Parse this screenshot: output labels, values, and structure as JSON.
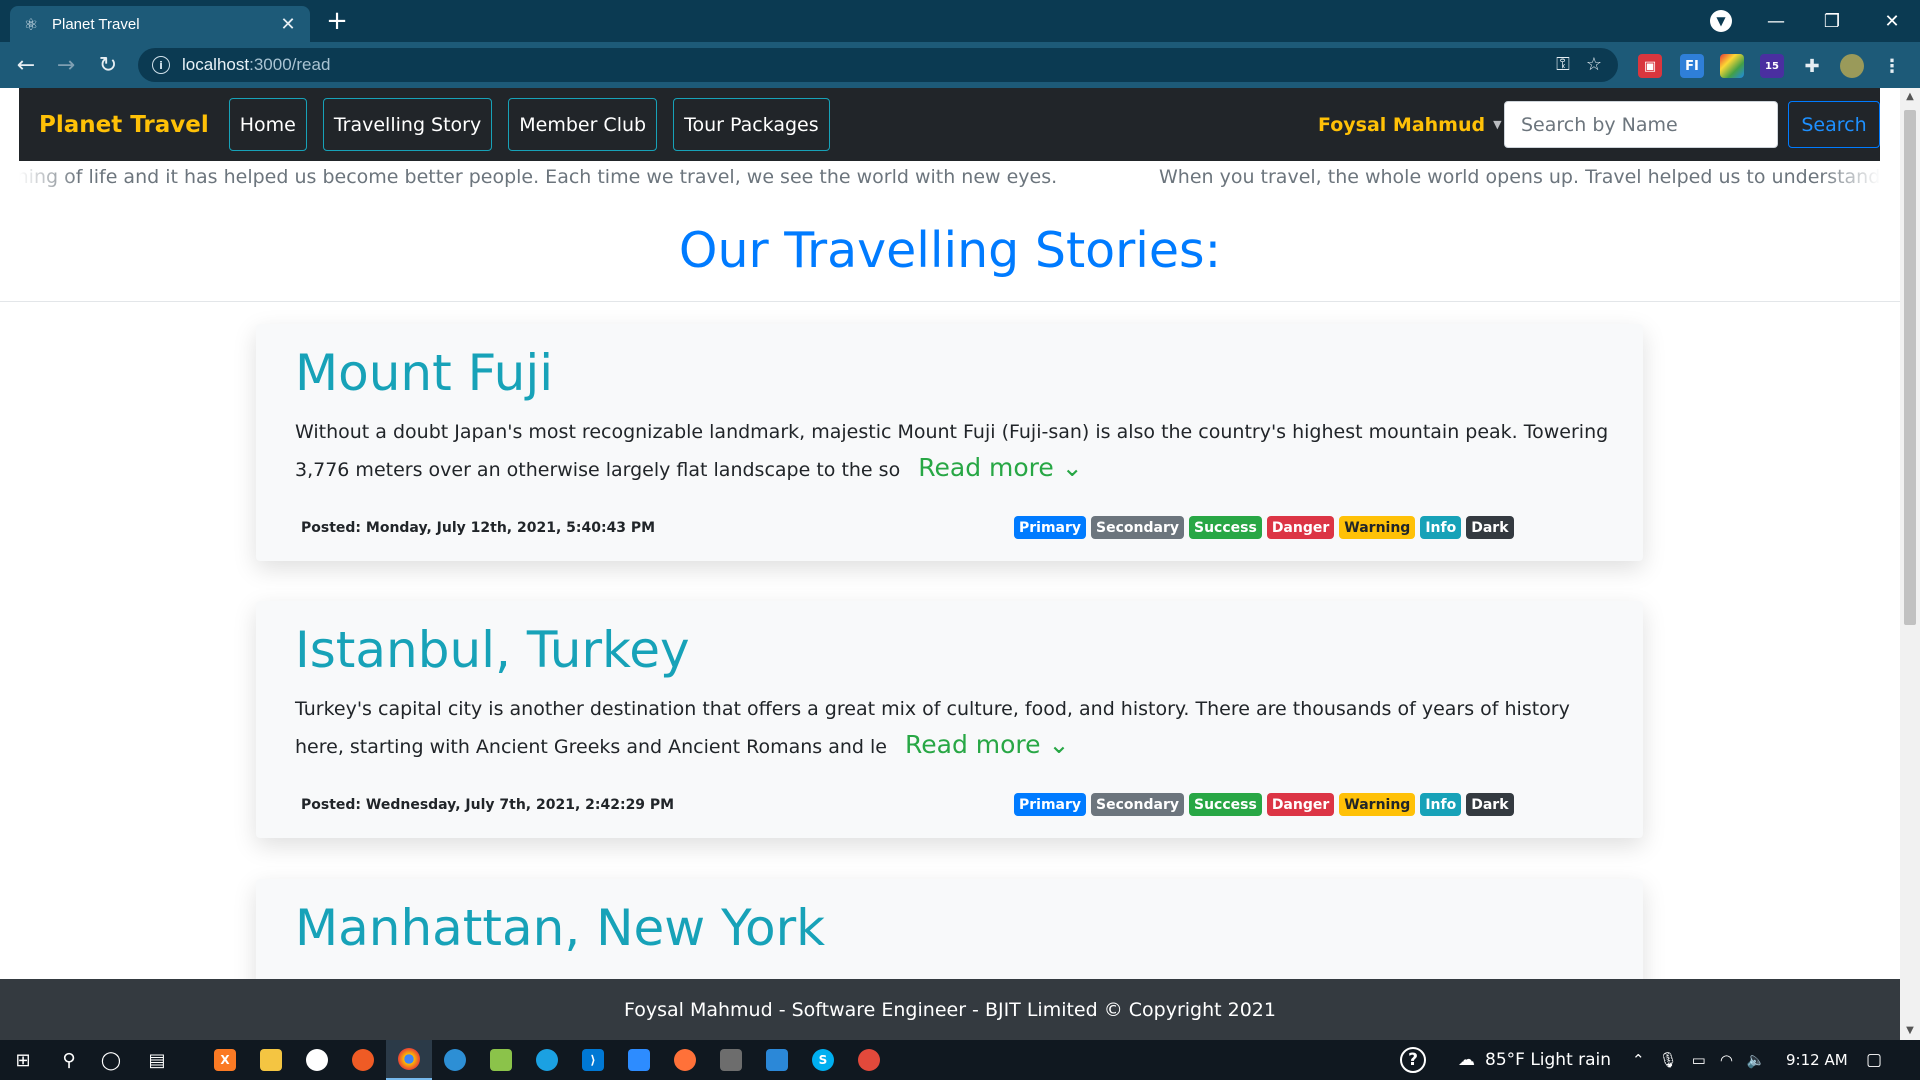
{
  "browser": {
    "tab_title": "Planet Travel",
    "new_tab_symbol": "+",
    "url_host": "localhost",
    "url_path": ":3000/read",
    "extension_badge_count": "15"
  },
  "navbar": {
    "brand": "Planet Travel",
    "links": [
      "Home",
      "Travelling Story",
      "Member Club",
      "Tour Packages"
    ],
    "user_name": "Foysal Mahmud",
    "search_placeholder": "Search by Name",
    "search_button": "Search"
  },
  "marquee": {
    "left_text": "aning of life and it has helped us become better people. Each time we travel, we see the world with new eyes.",
    "right_text": "When you travel, the whole world opens up. Travel helped us to understand the m"
  },
  "page_heading": "Our Travelling Stories:",
  "stories": [
    {
      "title": "Mount Fuji",
      "body": "Without a doubt Japan's most recognizable landmark, majestic Mount Fuji (Fuji-san) is also the country's highest mountain peak. Towering 3,776 meters over an otherwise largely flat landscape to the so",
      "read_more": "Read more",
      "posted": "Posted: Monday, July 12th, 2021, 5:40:43 PM"
    },
    {
      "title": "Istanbul, Turkey",
      "body": "Turkey's capital city is another destination that offers a great mix of culture, food, and history. There are thousands of years of history here, starting with Ancient Greeks and Ancient Romans and le",
      "read_more": "Read more",
      "posted": "Posted: Wednesday, July 7th, 2021, 2:42:29 PM"
    },
    {
      "title": "Manhattan, New York"
    }
  ],
  "badges": [
    "Primary",
    "Secondary",
    "Success",
    "Danger",
    "Warning",
    "Info",
    "Dark"
  ],
  "footer": "Foysal Mahmud - Software Engineer - BJIT Limited © Copyright 2021",
  "taskbar": {
    "weather": "85°F  Light rain",
    "time": "9:12 AM"
  },
  "colors": {
    "brand": "#ffc107",
    "heading": "#007bff",
    "card_title": "#17a2b8",
    "read_more": "#28a745",
    "navbar_bg": "#212529",
    "footer_bg": "#343a40",
    "chrome_tab": "#1d5a78",
    "chrome_bar": "#0b3a52"
  }
}
